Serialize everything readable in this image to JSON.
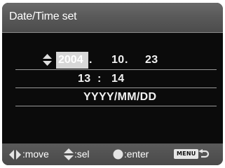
{
  "screen": {
    "title": "Date/Time set"
  },
  "date_row": {
    "year": "2004",
    "year_separator": ".",
    "month": "10",
    "month_separator": ".",
    "day": "23"
  },
  "time_row": {
    "hour": "13",
    "separator": ":",
    "minute": "14"
  },
  "format_row": {
    "value": "YYYY/MM/DD"
  },
  "footer": {
    "move_label": ":move",
    "sel_label": ":sel",
    "enter_label": ":enter",
    "menu_label": "MENU"
  },
  "icons": {
    "up_down": "up-down-arrows-icon",
    "left_right": "left-right-arrows-icon",
    "center_button": "center-button-icon",
    "return": "return-icon"
  },
  "colors": {
    "background": "#0b0b0b",
    "title_bar": "#5a5a5a",
    "highlight": "#d7d7d7",
    "text": "#ffffff"
  }
}
